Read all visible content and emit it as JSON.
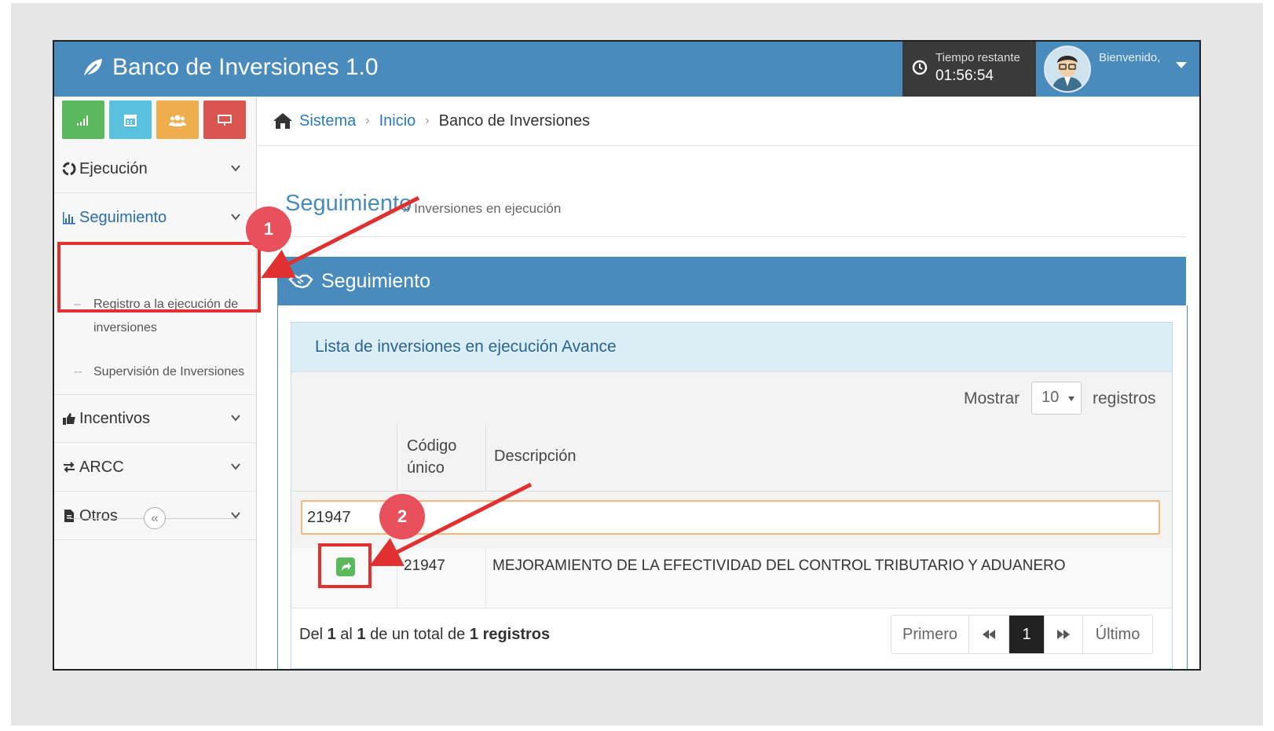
{
  "header": {
    "brand": "Banco de Inversiones 1.0",
    "timer_label": "Tiempo restante",
    "timer_value": "01:56:54",
    "welcome": "Bienvenido,"
  },
  "sidebar": {
    "shortcuts": [
      {
        "icon": "bar-chart-icon",
        "color": "#5cb85c"
      },
      {
        "icon": "calendar-icon",
        "color": "#5bc0de"
      },
      {
        "icon": "users-icon",
        "color": "#f0ad4e"
      },
      {
        "icon": "monitor-icon",
        "color": "#d9534f"
      }
    ],
    "items": [
      {
        "label": "Ejecución",
        "icon": "recycle-icon"
      },
      {
        "label": "Seguimiento",
        "icon": "bar-chart-icon",
        "active": true,
        "subitems": [
          "Registro a la ejecución de inversiones",
          "Supervisión de Inversiones"
        ]
      },
      {
        "label": "Incentivos",
        "icon": "thumbs-up-icon"
      },
      {
        "label": "ARCC",
        "icon": "exchange-icon"
      },
      {
        "label": "Otros",
        "icon": "file-icon"
      }
    ],
    "collapse_symbol": "«"
  },
  "breadcrumb": {
    "items": [
      "Sistema",
      "Inicio",
      "Banco de Inversiones"
    ],
    "separator": "›"
  },
  "page": {
    "title": "Seguimiento",
    "subtitle": "» Inversiones en ejecución"
  },
  "panel": {
    "title": "Seguimiento",
    "box_title": "Lista de inversiones en ejecución Avance",
    "show_label": "Mostrar",
    "show_value": "10",
    "records_label": "registros",
    "columns": [
      "",
      "Código único",
      "Descripción"
    ],
    "filter_value": "21947",
    "rows": [
      {
        "code": "21947",
        "description": "MEJORAMIENTO DE LA EFECTIVIDAD DEL CONTROL TRIBUTARIO Y ADUANERO"
      }
    ],
    "info": {
      "prefix": "Del",
      "from": "1",
      "al": "al",
      "to": "1",
      "mid": "de un total de",
      "total": "1",
      "suffix": "registros"
    },
    "pager": {
      "first": "Primero",
      "prev": "«",
      "current": "1",
      "next": "»",
      "last": "Último"
    }
  },
  "annotations": {
    "step1": "1",
    "step2": "2",
    "color": "#e03030"
  }
}
